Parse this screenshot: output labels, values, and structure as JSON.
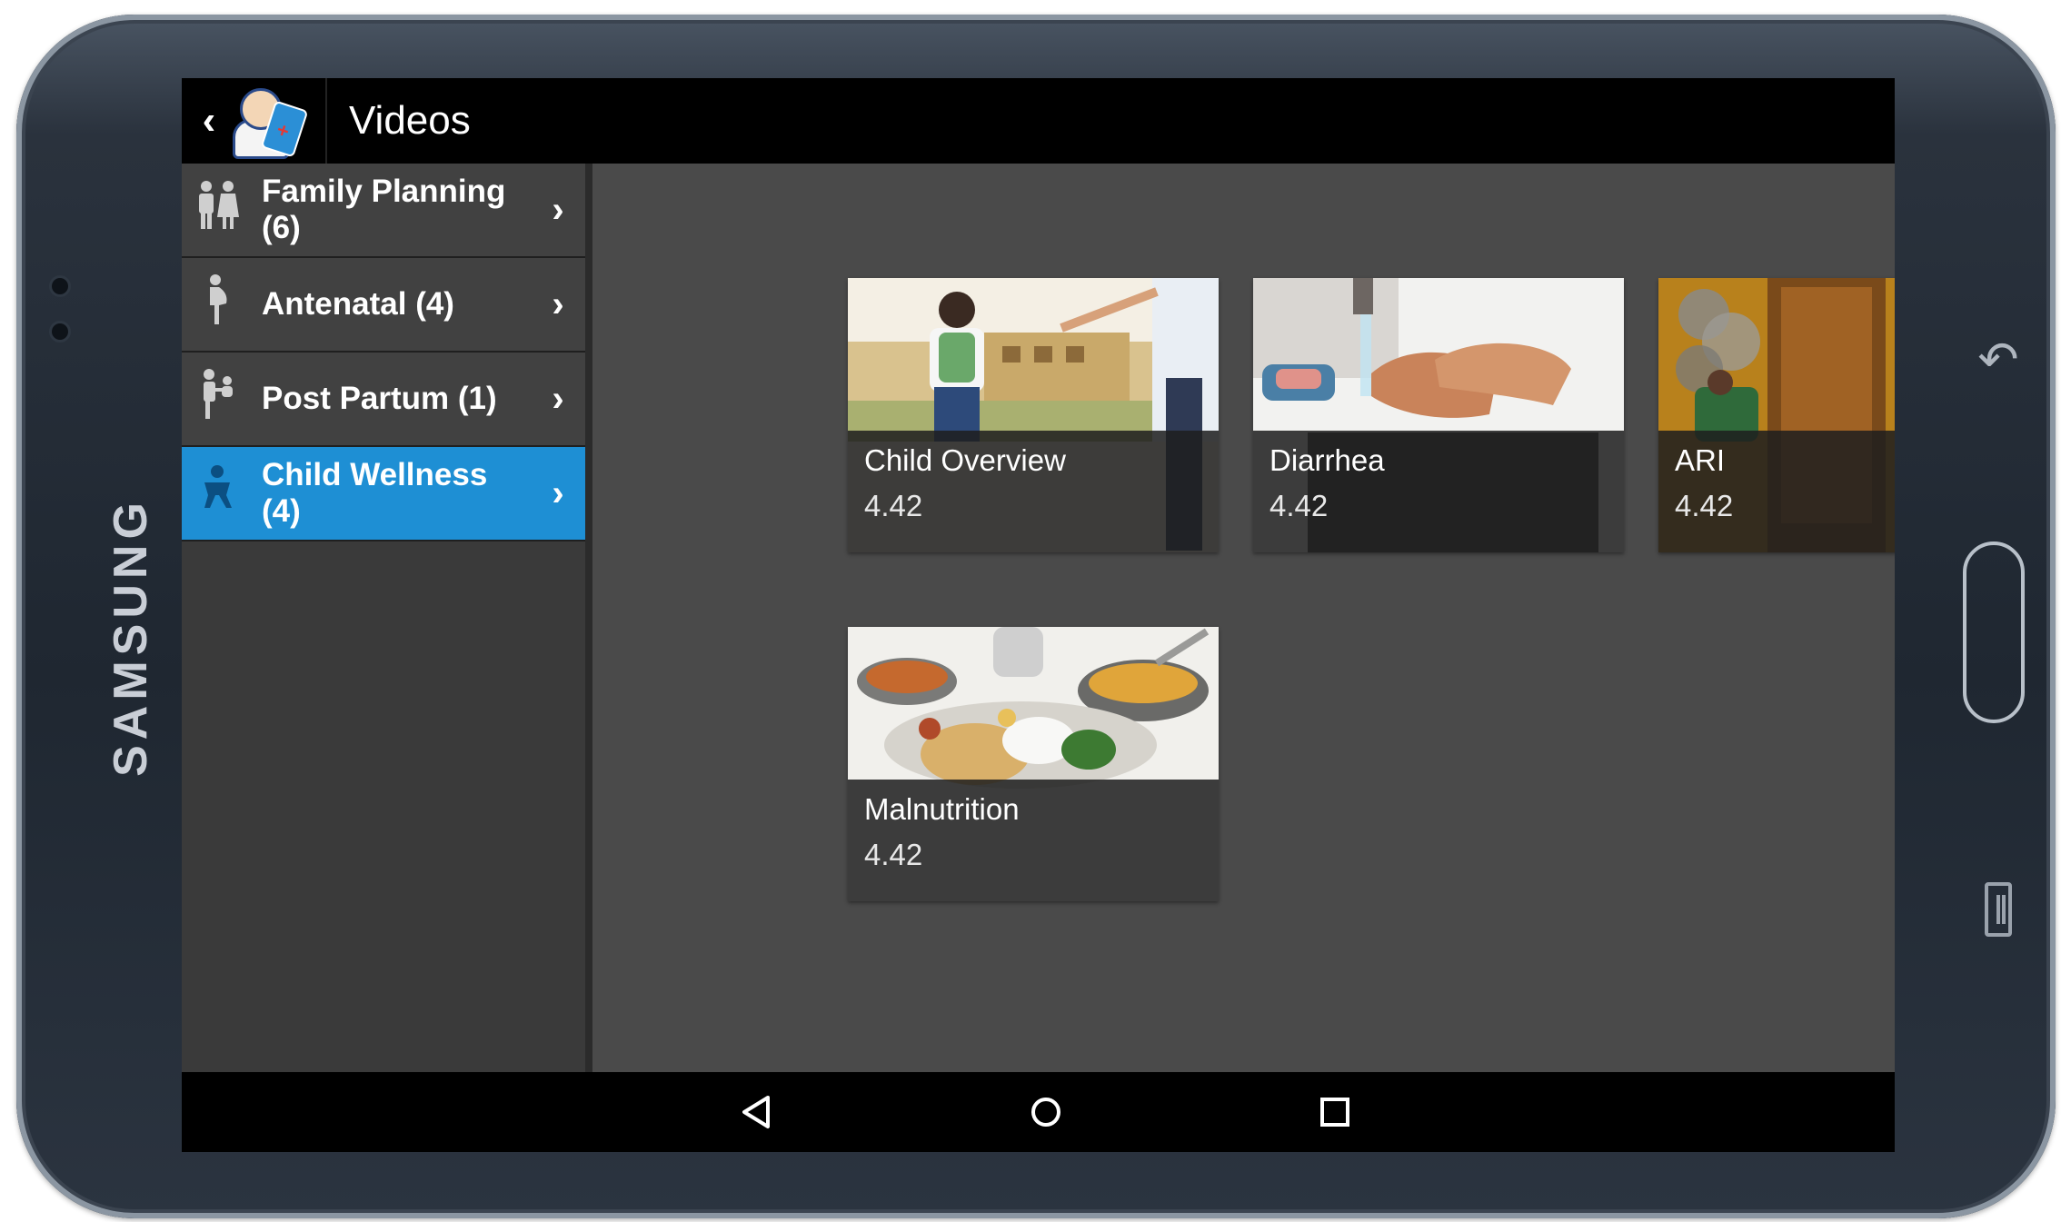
{
  "device": {
    "brand": "SAMSUNG"
  },
  "app_bar": {
    "title": "Videos"
  },
  "sidebar": {
    "items": [
      {
        "label": "Family Planning (6)",
        "icon": "couple-icon",
        "active": false
      },
      {
        "label": "Antenatal (4)",
        "icon": "pregnant-woman-icon",
        "active": false
      },
      {
        "label": "Post Partum (1)",
        "icon": "mother-baby-icon",
        "active": false
      },
      {
        "label": "Child Wellness (4)",
        "icon": "child-icon",
        "active": true
      }
    ]
  },
  "videos": [
    {
      "title": "Child Overview",
      "value": "4.42",
      "thumbnail": "child-walking-to-school"
    },
    {
      "title": "Diarrhea",
      "value": "4.42",
      "thumbnail": "hand-washing"
    },
    {
      "title": "ARI",
      "value": "4.42",
      "thumbnail": "smoky-house"
    },
    {
      "title": "Malnutrition",
      "value": "4.42",
      "thumbnail": "meal-plate"
    }
  ],
  "colors": {
    "accent": "#1e8fd4",
    "content_bg": "#4a4a4a",
    "sidebar_bg": "#414141"
  }
}
